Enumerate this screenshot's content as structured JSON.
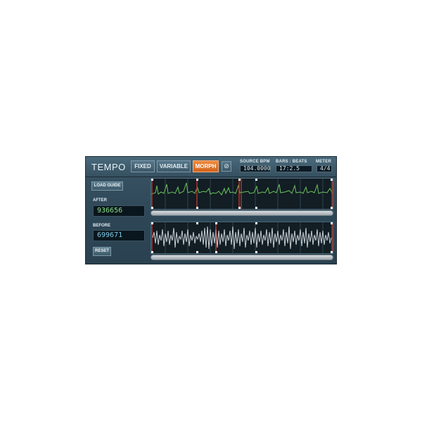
{
  "header": {
    "title": "TEMPO",
    "modes": [
      "FIXED",
      "VARIABLE",
      "MORPH"
    ],
    "active_mode": "MORPH",
    "clear_icon": "no-entry-icon"
  },
  "fields": {
    "source_bpm_label": "SOURCE BPM",
    "source_bpm_value": "104.0000",
    "bars_beats_label": "BARS : BEATS",
    "bars_beats_value": "17:2.5",
    "meter_label": "METER",
    "meter_value": "4/4"
  },
  "left": {
    "load_guide": "LOAD GUIDE",
    "after_label": "AFTER",
    "after_value": "936656",
    "before_label": "BEFORE",
    "before_value": "699671",
    "reset": "RESET"
  },
  "colors": {
    "active_orange": "#e07028",
    "after_wave": "#6cc25a",
    "before_wave": "#c8d0d6",
    "marker_red": "#d63a2a"
  }
}
